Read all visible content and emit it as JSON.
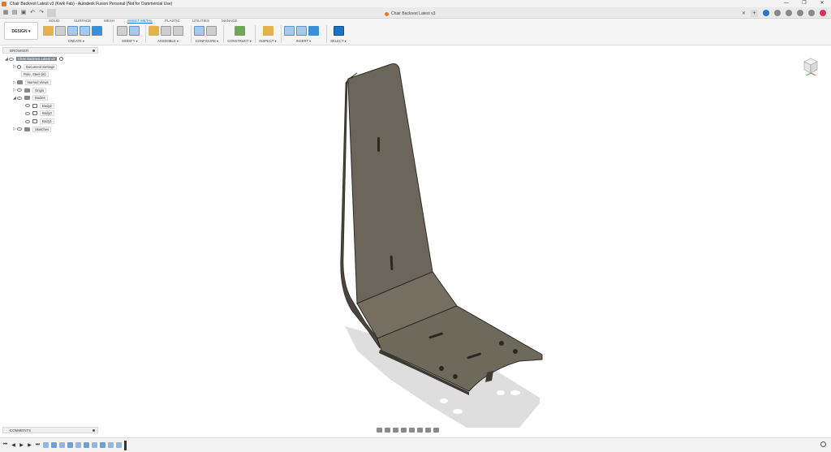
{
  "window": {
    "title": "Chair Backrest Latest v3 (Kwik Fab) - Autodesk Fusion Personal (Not for Commercial Use)",
    "controls": [
      "—",
      "❐",
      "✕"
    ]
  },
  "doc_tab": {
    "label": "Chair Backrest Latest v3",
    "close": "✕"
  },
  "ribbon": {
    "workspace": "DESIGN ▾",
    "tabs": [
      "SOLID",
      "SURFACE",
      "MESH",
      "SHEET METAL",
      "PLASTIC",
      "UTILITIES",
      "MANAGE"
    ],
    "active_tab": "SHEET METAL",
    "groups": [
      "CREATE ▾",
      "MODIFY ▾",
      "ASSEMBLE ▾",
      "CONFIGURE ▾",
      "CONSTRUCT ▾",
      "INSPECT ▾",
      "INSERT ▾",
      "SELECT ▾"
    ]
  },
  "browser": {
    "header": "BROWSER",
    "items": [
      {
        "label": "Chair Backrest Latest v3",
        "level": 0,
        "toggle": "◢",
        "icon": "component-icon"
      },
      {
        "label": "Document Settings",
        "level": 1,
        "toggle": "▷",
        "icon": "gear-icon"
      },
      {
        "label": "Rule, Steel (in)",
        "level": 1,
        "toggle": "",
        "icon": "sheet-rule-icon"
      },
      {
        "label": "Named Views",
        "level": 1,
        "toggle": "▷",
        "icon": "folder-icon"
      },
      {
        "label": "Origin",
        "level": 1,
        "toggle": "▷",
        "icon": "folder-icon"
      },
      {
        "label": "Bodies",
        "level": 1,
        "toggle": "◢",
        "icon": "folder-icon"
      },
      {
        "label": "Body2",
        "level": 2,
        "toggle": "",
        "icon": "body-icon"
      },
      {
        "label": "Body3",
        "level": 2,
        "toggle": "",
        "icon": "body-icon"
      },
      {
        "label": "Body1",
        "level": 2,
        "toggle": "",
        "icon": "body-icon"
      },
      {
        "label": "Sketches",
        "level": 1,
        "toggle": "▷",
        "icon": "folder-icon"
      }
    ]
  },
  "comments": {
    "header": "COMMENTS"
  },
  "timeline": {
    "playback": [
      "⏮",
      "◀",
      "▶",
      "▶",
      "⏭"
    ]
  },
  "colors": {
    "accent": "#1a73c9",
    "body_fill": "#6b6659",
    "body_edge": "#2d2b27",
    "shadow": "#dcdcdc"
  }
}
